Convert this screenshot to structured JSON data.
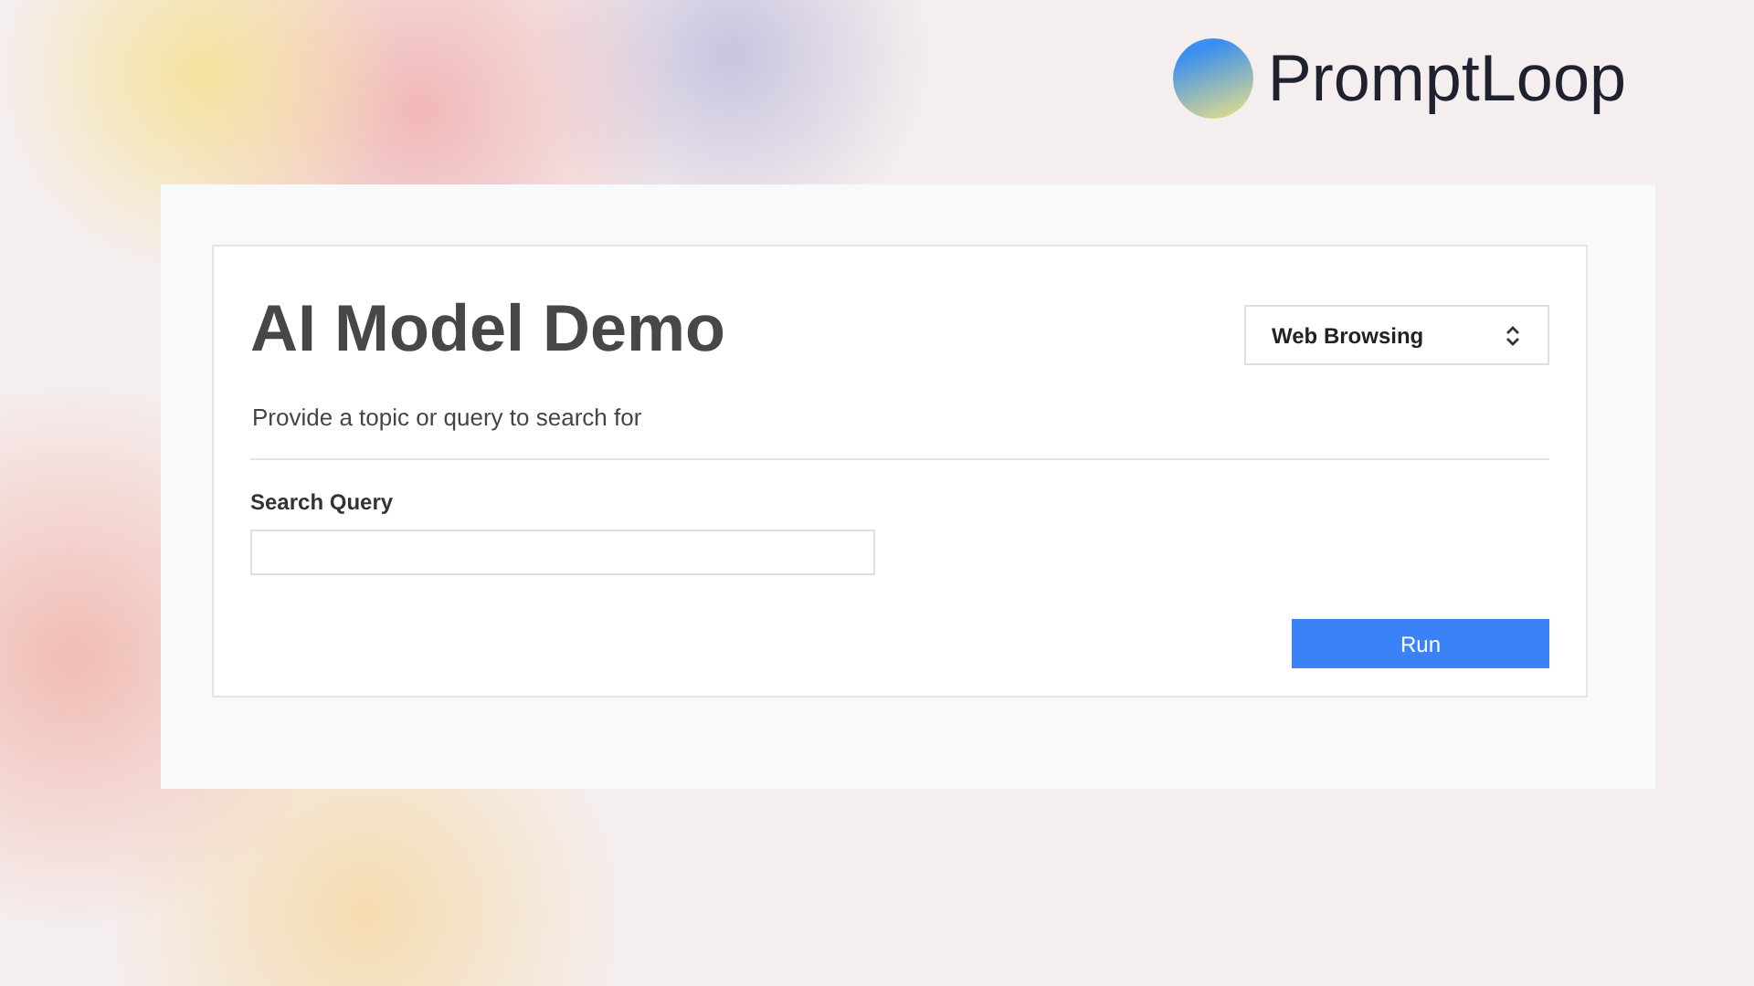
{
  "brand": {
    "name": "PromptLoop"
  },
  "demo": {
    "title": "AI Model Demo",
    "mode_select": {
      "value": "Web Browsing"
    },
    "description": "Provide a topic or query to search for",
    "fields": [
      {
        "label": "Search Query"
      }
    ],
    "buttons": [
      "Run"
    ]
  }
}
